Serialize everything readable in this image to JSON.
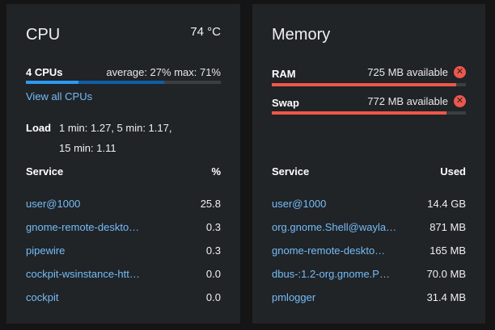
{
  "cpu": {
    "title": "CPU",
    "temperature": "74 °C",
    "usage_label": "4 CPUs",
    "usage_stats": "average: 27% max: 71%",
    "average_percent": 27,
    "max_percent": 71,
    "view_all_link": "View all CPUs",
    "load_label": "Load",
    "load_line1": "1 min: 1.27, 5 min: 1.17,",
    "load_line2": "15 min: 1.11",
    "table": {
      "col_service": "Service",
      "col_value": "%",
      "rows": [
        {
          "service": "user@1000",
          "value": "25.8"
        },
        {
          "service": "gnome-remote-deskto…",
          "value": "0.3"
        },
        {
          "service": "pipewire",
          "value": "0.3"
        },
        {
          "service": "cockpit-wsinstance-htt…",
          "value": "0.0"
        },
        {
          "service": "cockpit",
          "value": "0.0"
        }
      ]
    }
  },
  "memory": {
    "title": "Memory",
    "ram_label": "RAM",
    "ram_available": "725 MB available",
    "ram_used_fraction": 0.95,
    "swap_label": "Swap",
    "swap_available": "772 MB available",
    "swap_used_fraction": 0.9,
    "table": {
      "col_service": "Service",
      "col_value": "Used",
      "rows": [
        {
          "service": "user@1000",
          "value": "14.4 GB"
        },
        {
          "service": "org.gnome.Shell@wayla…",
          "value": "871 MB"
        },
        {
          "service": "gnome-remote-deskto…",
          "value": "165 MB"
        },
        {
          "service": "dbus-:1.2-org.gnome.P…",
          "value": "70.0 MB"
        },
        {
          "service": "pmlogger",
          "value": "31.4 MB"
        }
      ]
    }
  },
  "colors": {
    "bar_average": "#2b9af3",
    "bar_max": "#0f5fa8",
    "memory_danger": "#f0574a",
    "link": "#73bcf7"
  }
}
